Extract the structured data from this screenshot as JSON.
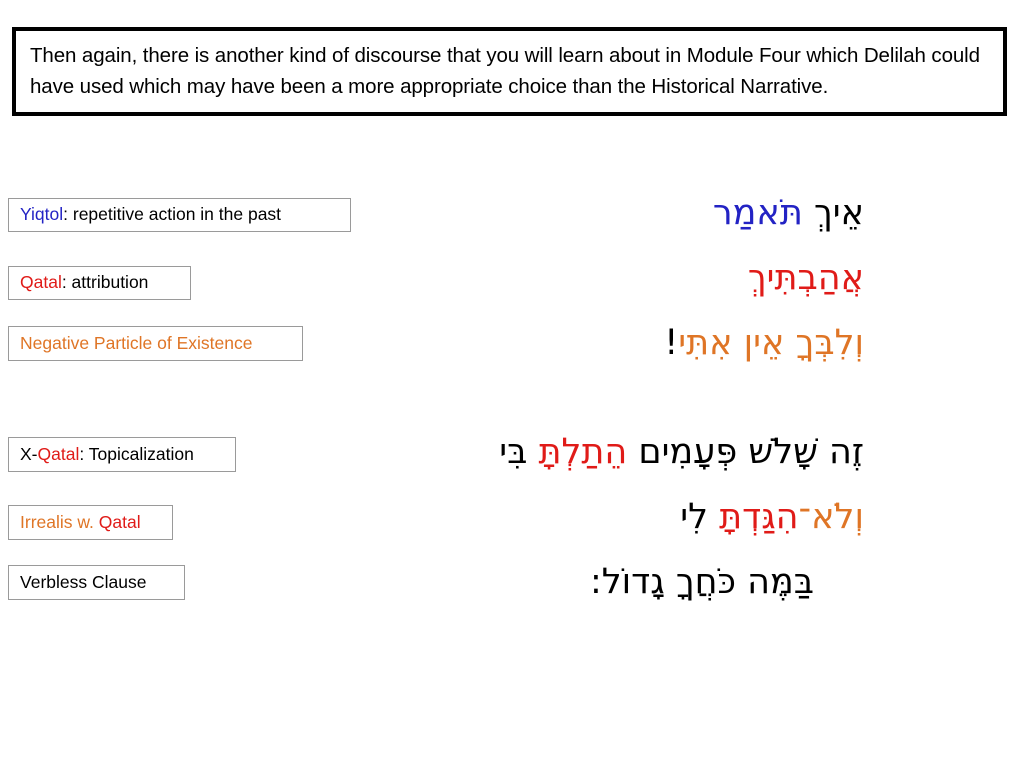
{
  "callout": {
    "text": "Then again, there is another kind of discourse that you will learn about in Module Four which Delilah could have used which may have been a more appropriate choice than the Historical Narrative."
  },
  "colors": {
    "blue": "#2323C4",
    "red": "#E01B18",
    "orange": "#DF7526",
    "black": "#000000",
    "box_border": "#9A9A9A",
    "callout_border": "#000000"
  },
  "labels": [
    {
      "name": "yiqtol",
      "parts": [
        {
          "text": "Yiqtol",
          "color": "blue"
        },
        {
          "text": ": repetitive action in the past",
          "color": "black"
        }
      ],
      "full_text": "Yiqtol: repetitive action in the past"
    },
    {
      "name": "qatal",
      "parts": [
        {
          "text": "Qatal",
          "color": "red"
        },
        {
          "text": ": attribution",
          "color": "black"
        }
      ],
      "full_text": "Qatal: attribution"
    },
    {
      "name": "negative-particle-of-existence",
      "parts": [
        {
          "text": "Negative Particle of Existence",
          "color": "orange"
        }
      ],
      "full_text": "Negative Particle of Existence"
    },
    {
      "name": "x-qatal",
      "parts": [
        {
          "text": "X-",
          "color": "black"
        },
        {
          "text": "Qatal",
          "color": "red"
        },
        {
          "text": ": Topicalization",
          "color": "black"
        }
      ],
      "full_text": "X-Qatal: Topicalization"
    },
    {
      "name": "irrealis-w-qatal",
      "parts": [
        {
          "text": "Irrealis w. ",
          "color": "orange"
        },
        {
          "text": "Qatal",
          "color": "red"
        }
      ],
      "full_text": "Irrealis w. Qatal"
    },
    {
      "name": "verbless-clause",
      "parts": [
        {
          "text": "Verbless Clause",
          "color": "black"
        }
      ],
      "full_text": "Verbless Clause"
    }
  ],
  "hebrew_lines": [
    {
      "name": "line-1",
      "segments": [
        {
          "text": "אֵיךְ ",
          "color": "black"
        },
        {
          "text": "תֹּאמַר",
          "color": "blue"
        }
      ],
      "full_text": "אֵיךְ תֹּאמַר"
    },
    {
      "name": "line-2",
      "segments": [
        {
          "text": "אֲהַבְתִּיךְ",
          "color": "red"
        }
      ],
      "full_text": "אֲהַבְתִּיךְ"
    },
    {
      "name": "line-3",
      "segments": [
        {
          "text": "וְלִבְּךָ אֵין אִתִּי",
          "color": "orange"
        },
        {
          "text": "!",
          "color": "black"
        }
      ],
      "full_text": "וְלִבְּךָ אֵין אִתִּי!"
    },
    {
      "name": "line-4",
      "segments": [
        {
          "text": "זֶה שָׁלֹשׁ פְּעָמִים ",
          "color": "black"
        },
        {
          "text": "הֵתַלְתָּ",
          "color": "red"
        },
        {
          "text": " בִּי",
          "color": "black"
        }
      ],
      "full_text": "זֶה שָׁלֹשׁ פְּעָמִים הֵתַלְתָּ בִּי"
    },
    {
      "name": "line-5",
      "segments": [
        {
          "text": "וְלֹא־",
          "color": "orange"
        },
        {
          "text": "הִגַּדְתָּ",
          "color": "red"
        },
        {
          "text": " לִי",
          "color": "black"
        }
      ],
      "full_text": "וְלֹא־הִגַּדְתָּ לִי"
    },
    {
      "name": "line-6",
      "segments": [
        {
          "text": "בַּמֶּה כֹּחֲךָ גָדוֹל:",
          "color": "black"
        }
      ],
      "full_text": "בַּמֶּה כֹּחֲךָ גָדוֹל:"
    }
  ]
}
